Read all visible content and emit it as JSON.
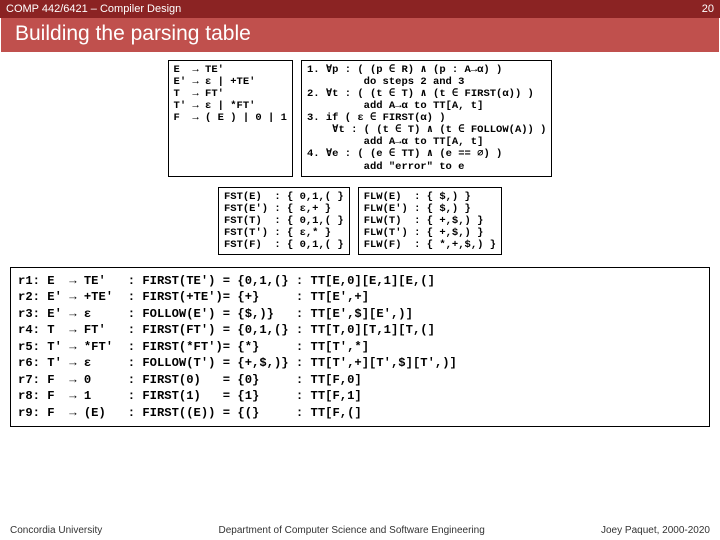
{
  "header": {
    "course": "COMP 442/6421 – Compiler Design",
    "page": "20"
  },
  "title": "Building the parsing table",
  "grammar": "E  → TE'\nE' → ε | +TE'\nT  → FT'\nT' → ε | *FT'\nF  → ( E ) | 0 | 1",
  "first": "FST(E)  : { 0,1,( }\nFST(E') : { ε,+ }\nFST(T)  : { 0,1,( }\nFST(T') : { ε,* }\nFST(F)  : { 0,1,( }",
  "follow": "FLW(E)  : { $,) }\nFLW(E') : { $,) }\nFLW(T)  : { +,$,) }\nFLW(T') : { +,$,) }\nFLW(F)  : { *,+,$,) }",
  "algo": "1. ∀p : ( (p ∈ R) ∧ (p : A→α) )\n         do steps 2 and 3\n2. ∀t : ( (t ∈ T) ∧ (t ∈ FIRST(α)) )\n         add A→α to TT[A, t]\n3. if ( ε ∈ FIRST(α) )\n    ∀t : ( (t ∈ T) ∧ (t ∈ FOLLOW(A)) )\n         add A→α to TT[A, t]\n4. ∀e : ( (e ∈ TT) ∧ (e == ∅) )\n         add \"error\" to e",
  "table": "r1: E  → TE'   : FIRST(TE') = {0,1,(} : TT[E,0][E,1][E,(]\nr2: E' → +TE'  : FIRST(+TE')= {+}     : TT[E',+]\nr3: E' → ε     : FOLLOW(E') = {$,)}   : TT[E',$][E',)]\nr4: T  → FT'   : FIRST(FT') = {0,1,(} : TT[T,0][T,1][T,(]\nr5: T' → *FT'  : FIRST(*FT')= {*}     : TT[T',*]\nr6: T' → ε     : FOLLOW(T') = {+,$,)} : TT[T',+][T',$][T',)]\nr7: F  → 0     : FIRST(0)   = {0}     : TT[F,0]\nr8: F  → 1     : FIRST(1)   = {1}     : TT[F,1]\nr9: F  → (E)   : FIRST((E)) = {(}     : TT[F,(]",
  "footer": {
    "left": "Concordia University",
    "center": "Department of Computer Science and Software Engineering",
    "right": "Joey Paquet, 2000-2020"
  }
}
